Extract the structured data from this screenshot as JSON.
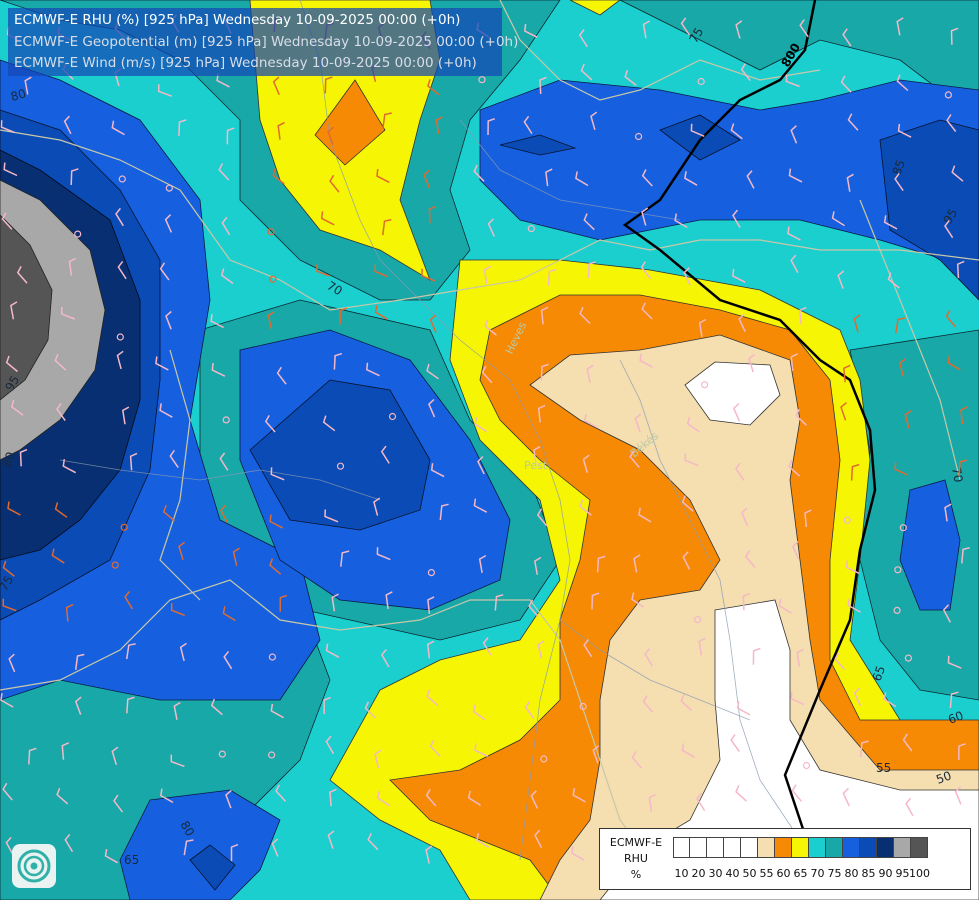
{
  "header": {
    "line1": "ECMWF-E RHU (%) [925 hPa] Wednesday 10-09-2025 00:00 (+0h)",
    "line2": "ECMWF-E Geopotential (m) [925 hPa] Wednesday 10-09-2025 00:00 (+0h)",
    "line3": "ECMWF-E Wind (m/s) [925 hPa] Wednesday 10-09-2025 00:00 (+0h)"
  },
  "legend": {
    "model": "ECMWF-E",
    "variable": "RHU",
    "unit": "%",
    "classes": [
      {
        "label": "10",
        "color": "#ffffff"
      },
      {
        "label": "20",
        "color": "#ffffff"
      },
      {
        "label": "30",
        "color": "#ffffff"
      },
      {
        "label": "40",
        "color": "#ffffff"
      },
      {
        "label": "50",
        "color": "#ffffff"
      },
      {
        "label": "55",
        "color": "#f5deb0"
      },
      {
        "label": "60",
        "color": "#f78a05"
      },
      {
        "label": "65",
        "color": "#f5f504"
      },
      {
        "label": "70",
        "color": "#1ccfcf"
      },
      {
        "label": "75",
        "color": "#18a8a8"
      },
      {
        "label": "80",
        "color": "#1660e0"
      },
      {
        "label": "85",
        "color": "#0b4bb5"
      },
      {
        "label": "90",
        "color": "#082f72"
      },
      {
        "label": "95",
        "color": "#a8a8a8"
      },
      {
        "label": "100",
        "color": "#555555"
      }
    ]
  },
  "contour_labels": [
    "75",
    "80",
    "800",
    "70",
    "95",
    "80",
    "85",
    "65",
    "95",
    "70",
    "65",
    "60",
    "55",
    "50",
    "75",
    "80"
  ],
  "place_labels": [
    "Heves",
    "Pest",
    "Békés"
  ],
  "colors": {
    "rh55": "#f5deb0",
    "rh60": "#f78a05",
    "rh65": "#f5f504",
    "rh70": "#1ccfcf",
    "rh75": "#18a8a8",
    "rh80": "#1660e0",
    "rh85": "#0b4bb5",
    "rh90": "#082f72",
    "rh95": "#a8a8a8",
    "rh100": "#555555",
    "geopotential": "#000000",
    "border": "#c8c8a8",
    "river": "#8a9ab0"
  }
}
